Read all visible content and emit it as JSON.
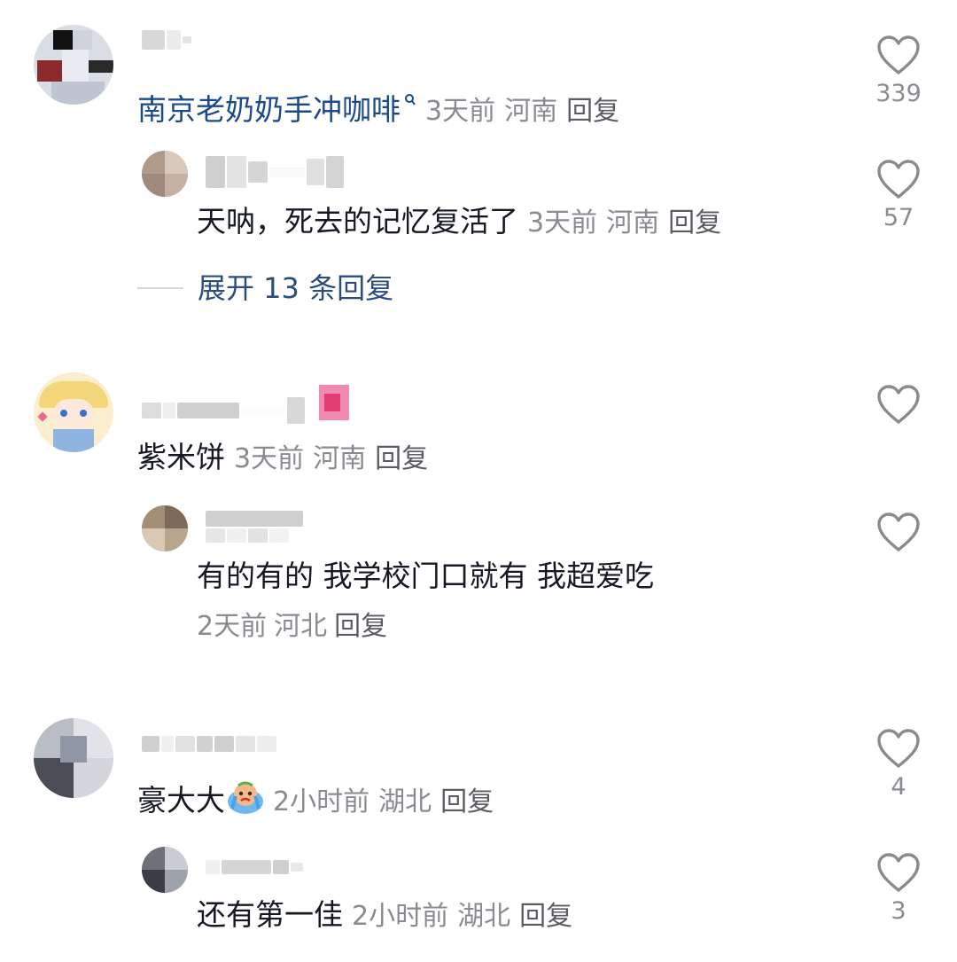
{
  "comments": [
    {
      "text": "南京老奶奶手冲咖啡",
      "search_glyph": "ᵠ",
      "time": "3天前",
      "location": "河南",
      "reply_label": "回复",
      "likes": "339",
      "is_link": true,
      "reply": {
        "text": "天呐，死去的记忆复活了",
        "time": "3天前",
        "location": "河南",
        "reply_label": "回复",
        "likes": "57"
      },
      "expand_label": "展开 13 条回复"
    },
    {
      "text": "紫米饼",
      "time": "3天前",
      "location": "河南",
      "reply_label": "回复",
      "likes": "",
      "reply": {
        "text": "有的有的 我学校门口就有 我超爱吃",
        "time": "2天前",
        "location": "河北",
        "reply_label": "回复",
        "likes": ""
      }
    },
    {
      "text": "豪大大",
      "emoji": "crying-face-emoji",
      "time": "2小时前",
      "location": "湖北",
      "reply_label": "回复",
      "likes": "4",
      "reply": {
        "text": "还有第一佳",
        "time": "2小时前",
        "location": "湖北",
        "reply_label": "回复",
        "likes": "3"
      }
    }
  ],
  "colors": {
    "text": "#161823",
    "meta": "#8a8b91",
    "link": "#1a4a8a",
    "expand": "#2b4c7e",
    "heart_stroke": "#8a8b91"
  }
}
